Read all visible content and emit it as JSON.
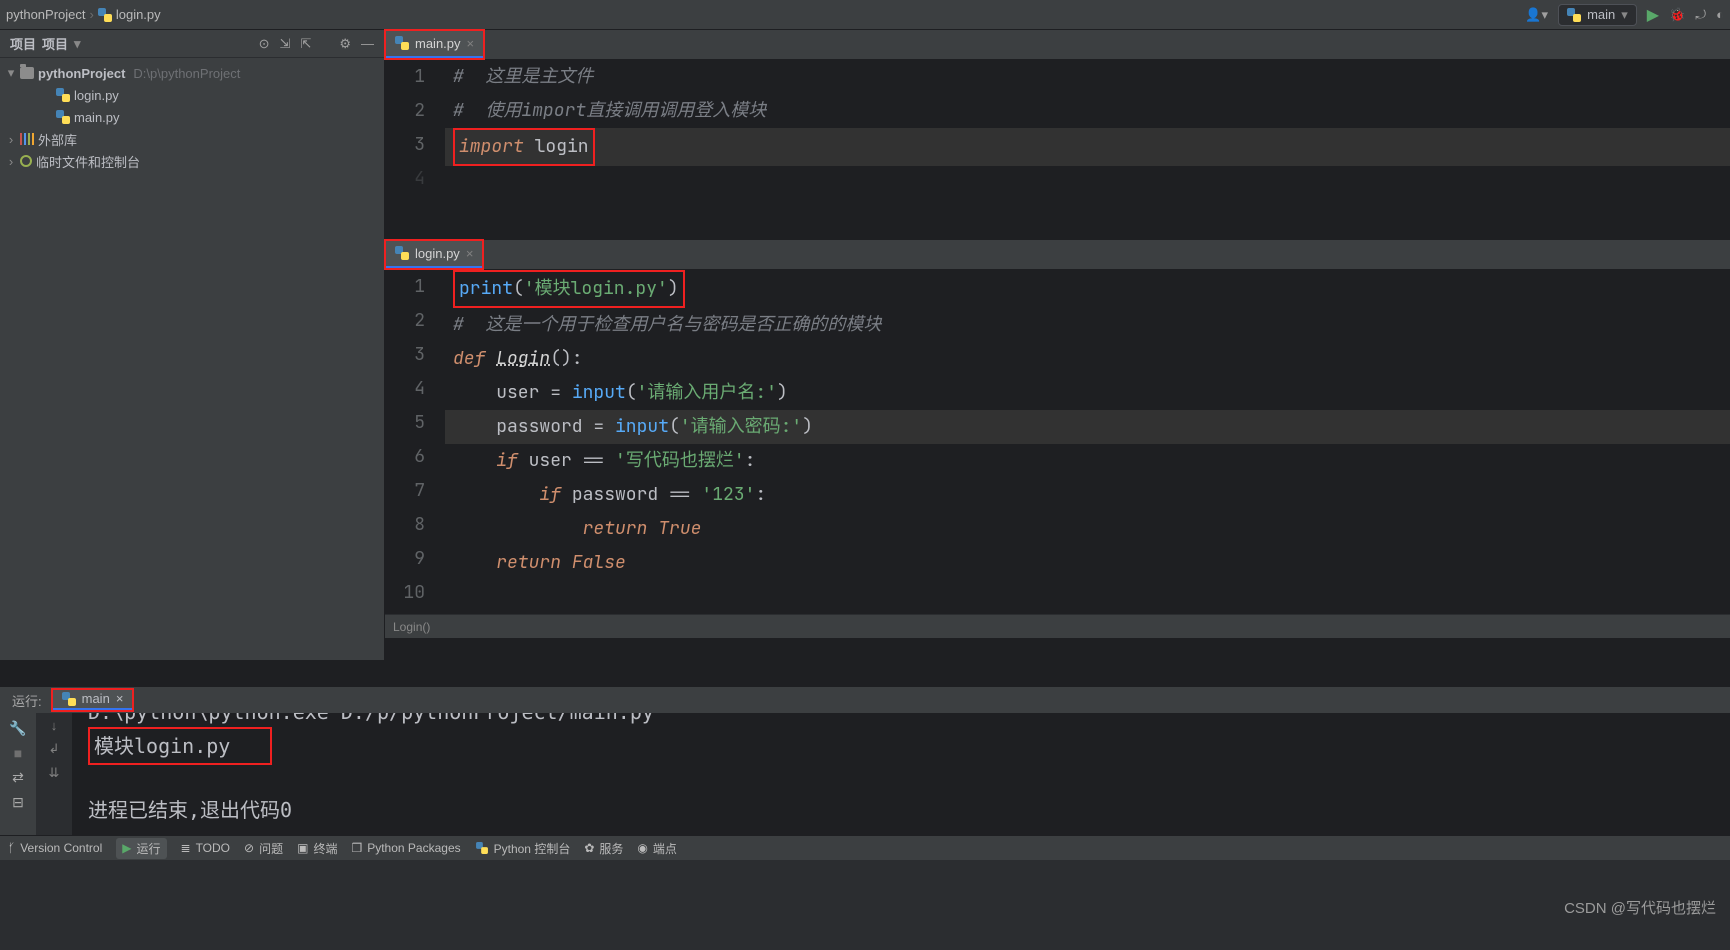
{
  "breadcrumb": {
    "project": "pythonProject",
    "file": "login.py"
  },
  "toolbar": {
    "run_config_label": "main",
    "icons": [
      "run",
      "debug",
      "coverage",
      "profile"
    ]
  },
  "project_panel": {
    "title": "项目",
    "root": "pythonProject",
    "root_path": "D:\\p\\pythonProject",
    "files": [
      "login.py",
      "main.py"
    ],
    "external_libs": "外部库",
    "scratches": "临时文件和控制台"
  },
  "editors": {
    "main": {
      "tab": "main.py",
      "lines": {
        "l1": "#  这里是主文件",
        "l2": "#  使用import直接调用调用登入模块",
        "l3_kw": "import ",
        "l3_name": "login"
      }
    },
    "login": {
      "tab": "login.py",
      "crumb": "Login()",
      "lines": {
        "l1_fn": "print",
        "l1_str": "'模块login.py'",
        "l2": "#  这是一个用于检查用户名与密码是否正确的的模块",
        "l3_def": "def ",
        "l3_name": "Login",
        "l3_tail": "():",
        "l4_a": "    user = ",
        "l4_fn": "input",
        "l4_str": "'请输入用户名:'",
        "l5_a": "    password = ",
        "l5_fn": "input",
        "l5_str": "'请输入密码:'",
        "l6_a": "    ",
        "l6_kw": "if ",
        "l6_b": "user == ",
        "l6_str": "'写代码也摆烂'",
        "l6_c": ":",
        "l7_a": "        ",
        "l7_kw": "if ",
        "l7_b": "password == ",
        "l7_str": "'123'",
        "l7_c": ":",
        "l8_a": "            ",
        "l8_kw": "return ",
        "l8_v": "True",
        "l9_a": "    ",
        "l9_kw": "return ",
        "l9_v": "False"
      }
    }
  },
  "run_panel": {
    "label": "运行:",
    "tab": "main",
    "command": "D:\\python\\python.exe D:/p/pythonProject/main.py",
    "output1": "模块login.py",
    "output2": "进程已结束,退出代码0"
  },
  "bottombar": {
    "version_control": "Version Control",
    "run": "运行",
    "todo": "TODO",
    "problems": "问题",
    "terminal": "终端",
    "packages": "Python Packages",
    "console": "Python 控制台",
    "services": "服务",
    "endpoints": "端点"
  },
  "watermark": "CSDN @写代码也摆烂"
}
